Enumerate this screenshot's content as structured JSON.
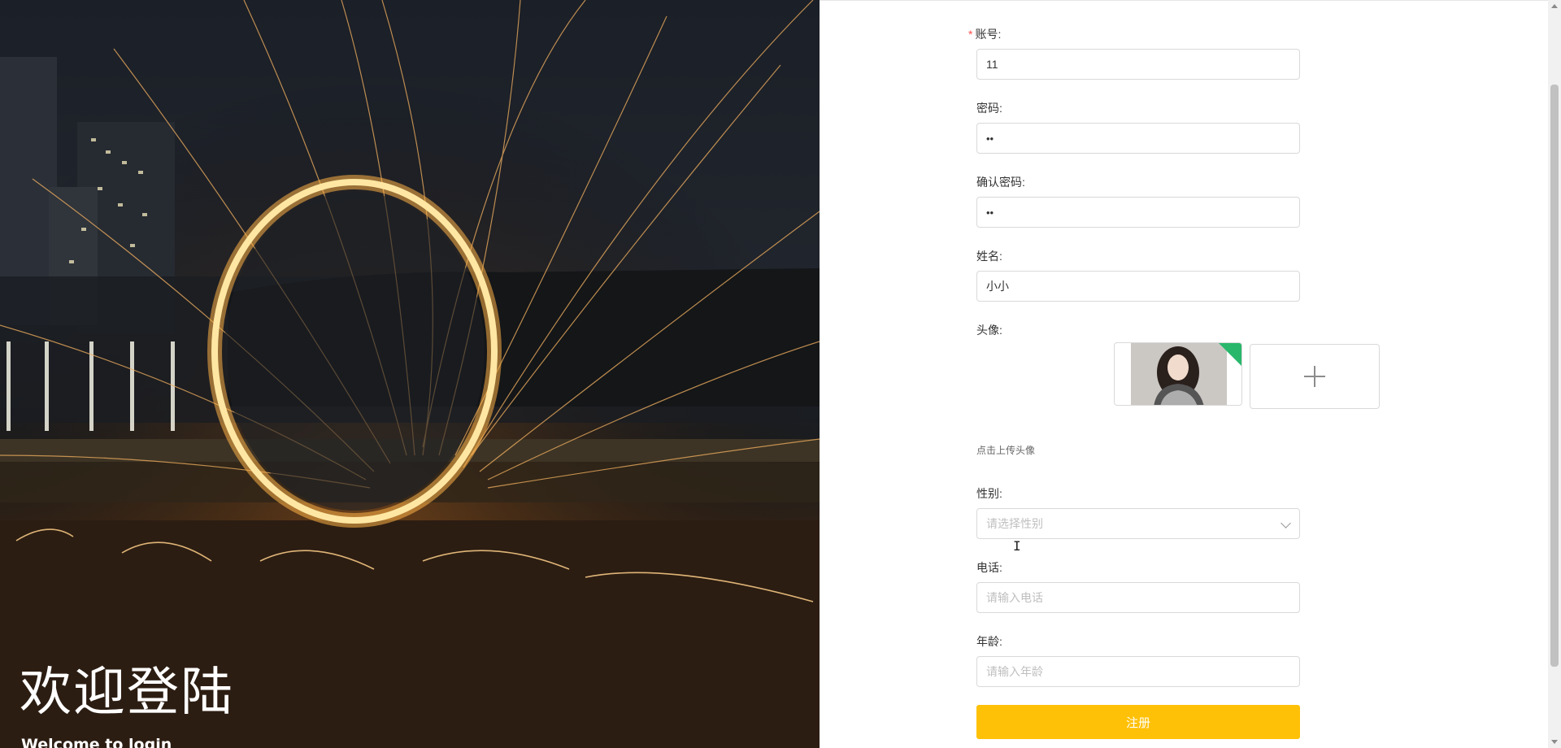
{
  "hero": {
    "title": "欢迎登陆",
    "subtitle": "Welcome to login"
  },
  "form": {
    "account": {
      "label": "账号:",
      "value": "11"
    },
    "password": {
      "label": "密码:",
      "value": "••"
    },
    "confirm_password": {
      "label": "确认密码:",
      "value": "••"
    },
    "name": {
      "label": "姓名:",
      "value": "小小"
    },
    "avatar": {
      "label": "头像:",
      "hint": "点击上传头像",
      "add_symbol": "+"
    },
    "gender": {
      "label": "性别:",
      "placeholder": "请选择性别"
    },
    "phone": {
      "label": "电话:",
      "placeholder": "请输入电话"
    },
    "age": {
      "label": "年龄:",
      "placeholder": "请输入年龄"
    },
    "submit_label": "注册"
  },
  "colors": {
    "accent": "#ffc107",
    "required": "#ff4d4f",
    "upload_success": "#28b76b"
  },
  "icons": {
    "chevron": "chevron-down-icon",
    "add": "plus-icon"
  }
}
